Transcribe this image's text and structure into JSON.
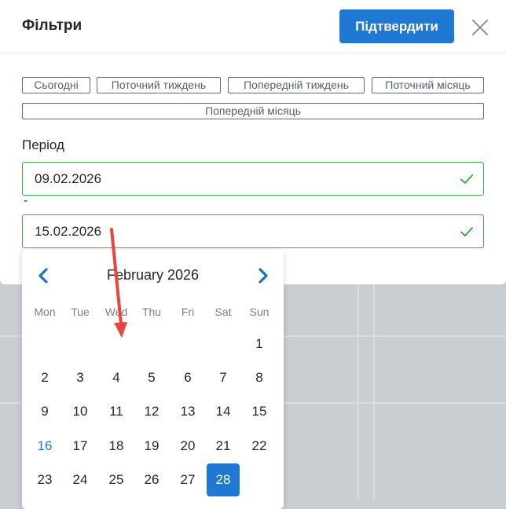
{
  "header": {
    "title": "Фільтри",
    "confirm_label": "Підтвердити"
  },
  "quick_filters": [
    {
      "label": "Сьогодні"
    },
    {
      "label": "Поточний тиждень"
    },
    {
      "label": "Попередній тиждень"
    },
    {
      "label": "Поточний місяць"
    },
    {
      "label": "Попередній місяць"
    }
  ],
  "period": {
    "label": "Період",
    "start_date": "09.02.2026",
    "separator": "-",
    "end_date": "15.02.2026"
  },
  "calendar": {
    "month_label": "February 2026",
    "weekdays": [
      "Mon",
      "Tue",
      "Wed",
      "Thu",
      "Fri",
      "Sat",
      "Sun"
    ],
    "weeks": [
      [
        "",
        "",
        "",
        "",
        "",
        "",
        "1"
      ],
      [
        "2",
        "3",
        "4",
        "5",
        "6",
        "7",
        "8"
      ],
      [
        "9",
        "10",
        "11",
        "12",
        "13",
        "14",
        "15"
      ],
      [
        "16",
        "17",
        "18",
        "19",
        "20",
        "21",
        "22"
      ],
      [
        "23",
        "24",
        "25",
        "26",
        "27",
        "28",
        ""
      ]
    ],
    "today": "16",
    "selected": "28"
  },
  "colors": {
    "accent": "#1f78d1",
    "valid": "#3bae4b",
    "annotation_arrow": "#e8453c"
  }
}
